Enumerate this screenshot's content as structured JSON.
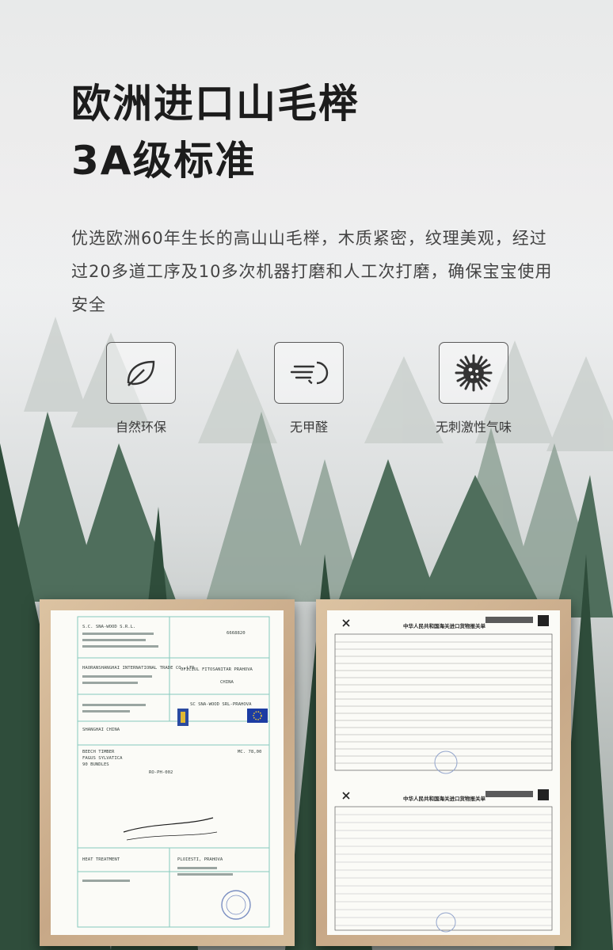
{
  "headline": {
    "line1": "欧洲进口山毛榉",
    "line2": "3A级标准"
  },
  "description": "优选欧洲60年生长的高山山毛榉，木质紧密，纹理美观，经过过20多道工序及10多次机器打磨和人工次打磨，确保宝宝使用安全",
  "features": [
    {
      "icon": "leaf-icon",
      "label": "自然环保"
    },
    {
      "icon": "wind-cloud-icon",
      "label": "无甲醛"
    },
    {
      "icon": "virus-icon",
      "label": "无刺激性气味"
    }
  ],
  "certificates": {
    "phyto": {
      "exporter": "S.C. SNA-WOOD S.R.L.",
      "cert_no": "6668820",
      "to": "OFICIUL FITOSANITAR PRAHOVA",
      "country": "CHINA",
      "importer": "HAORANSHANGHAI INTERNATIONAL TRADE CO.,LTD",
      "issuer": "SC SNA-WOOD SRL-PRAHOVA",
      "port": "SHANGHAI CHINA",
      "goods": "BEECH TIMBER",
      "latin": "FAGUS SYLVATICA",
      "bundles": "90 BUNDLES",
      "quantity": "MC. 78,00",
      "origin": "RO-PH-002",
      "treatment": "HEAT TREATMENT",
      "place": "PLOIESTI, PRAHOVA"
    },
    "customs": {
      "title": "中华人民共和国海关进口货物报关单"
    }
  }
}
